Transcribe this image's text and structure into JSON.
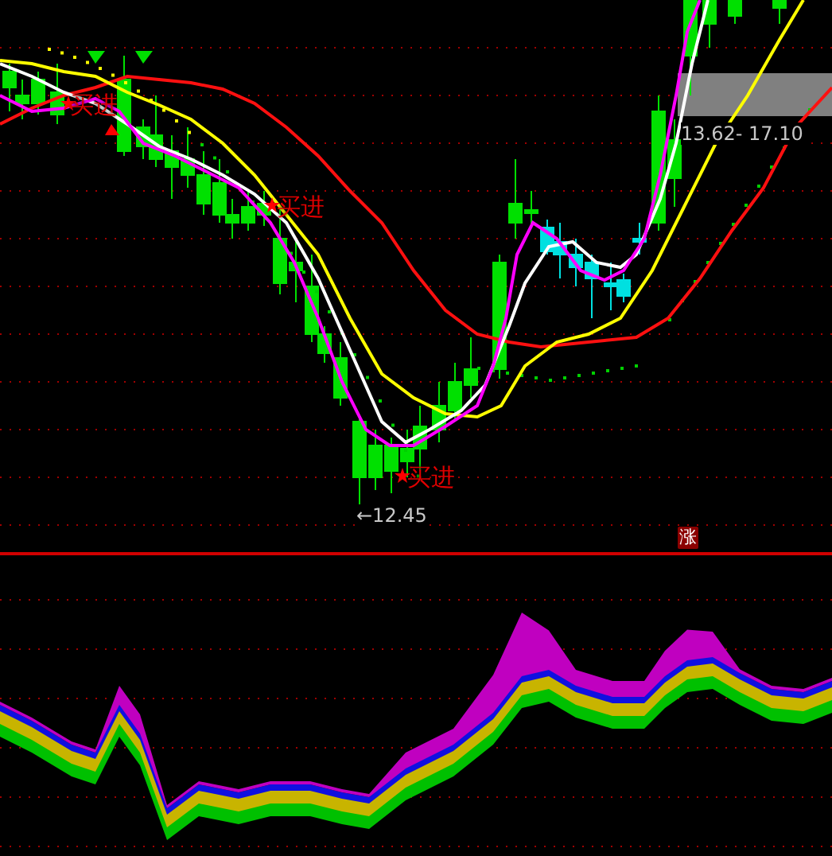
{
  "price_panel": {
    "signals": [
      {
        "label": "买进"
      },
      {
        "label": "买进"
      },
      {
        "label": "买进"
      }
    ],
    "low_label": "←12.45",
    "range_label": "13.62- 17.10"
  },
  "indicator_panel": {
    "badge": "涨"
  }
}
